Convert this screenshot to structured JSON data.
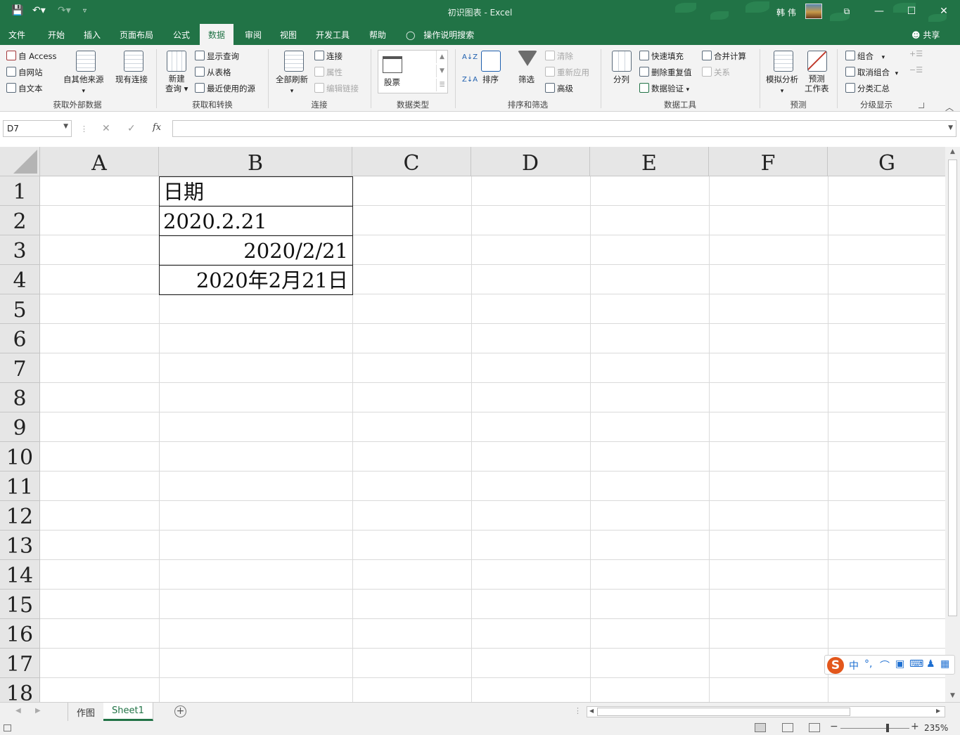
{
  "window": {
    "title": "初识图表 - Excel",
    "user": "韩 伟",
    "share_label": "共享",
    "minimize": "—",
    "restore": "☐",
    "close": "✕",
    "ribbon_display": "⧉"
  },
  "ribbon_tabs": [
    "文件",
    "开始",
    "插入",
    "页面布局",
    "公式",
    "数据",
    "审阅",
    "视图",
    "开发工具",
    "帮助"
  ],
  "active_tab": "数据",
  "tell_me": "操作说明搜索",
  "ribbon": {
    "get_external": {
      "label": "获取外部数据",
      "from_access": "自 Access",
      "from_web": "自网站",
      "from_text": "自文本",
      "from_other": "自其他来源",
      "existing_conn": "现有连接"
    },
    "get_transform": {
      "label": "获取和转换",
      "new_query_1": "新建",
      "new_query_2": "查询",
      "show_queries": "显示查询",
      "from_table": "从表格",
      "recent_sources": "最近使用的源"
    },
    "connections": {
      "label": "连接",
      "refresh_all": "全部刷新",
      "connections": "连接",
      "properties": "属性",
      "edit_links": "编辑链接"
    },
    "data_types": {
      "label": "数据类型",
      "stocks": "股票"
    },
    "sort_filter": {
      "label": "排序和筛选",
      "sort": "排序",
      "filter": "筛选",
      "clear": "清除",
      "reapply": "重新应用",
      "advanced": "高级"
    },
    "data_tools": {
      "label": "数据工具",
      "text_to_columns": "分列",
      "flash_fill": "快速填充",
      "remove_duplicates": "删除重复值",
      "data_validation": "数据验证",
      "consolidate": "合并计算",
      "relationships": "关系"
    },
    "forecast": {
      "label": "预测",
      "what_if": "模拟分析",
      "forecast_sheet_1": "预测",
      "forecast_sheet_2": "工作表"
    },
    "outline": {
      "label": "分级显示",
      "group": "组合",
      "ungroup": "取消组合",
      "subtotal": "分类汇总"
    }
  },
  "formula_bar": {
    "name_box": "D7",
    "cancel": "✕",
    "enter": "✓",
    "fx": "fx",
    "formula": ""
  },
  "sheet": {
    "columns": [
      "A",
      "B",
      "C",
      "D",
      "E",
      "F",
      "G"
    ],
    "rows": [
      "1",
      "2",
      "3",
      "4",
      "5",
      "6",
      "7",
      "8",
      "9",
      "10",
      "11",
      "12",
      "13",
      "14",
      "15",
      "16",
      "17",
      "18"
    ],
    "cells": {
      "B1": "日期",
      "B2": "2020.2.21",
      "B3": "2020/2/21",
      "B4": "2020年2月21日"
    }
  },
  "sheet_tabs": [
    "作图",
    "Sheet1"
  ],
  "active_sheet": "Sheet1",
  "add_sheet": "+",
  "ime": {
    "logo": "S",
    "mode": "中",
    "punct": "°,",
    "extra": "⌒"
  },
  "status": {
    "zoom": "235%",
    "zoom_minus": "−",
    "zoom_plus": "+",
    "zoom_fraction": 0.68
  }
}
